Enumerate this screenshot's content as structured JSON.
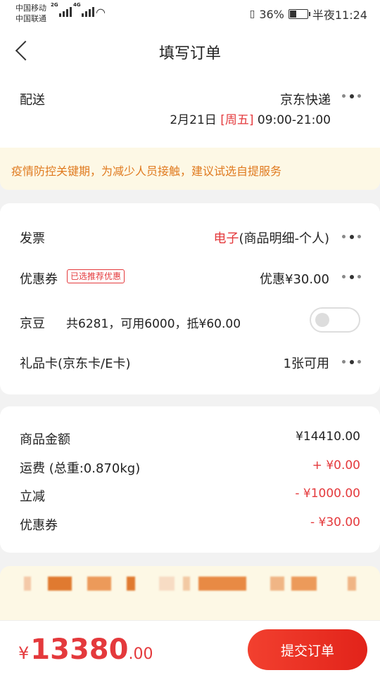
{
  "status_bar": {
    "carrier1": "中国移动",
    "carrier2": "中国联通",
    "net1": "2G",
    "net2": "4G",
    "battery": "36%",
    "battery_level": 0.36,
    "time": "半夜11:24"
  },
  "header": {
    "title": "填写订单"
  },
  "delivery": {
    "label": "配送",
    "method": "京东快递",
    "date": "2月21日",
    "weekday": "[周五]",
    "time_range": "09:00-21:00"
  },
  "notice": "疫情防控关键期，为减少人员接触，建议试选自提服务",
  "options": {
    "invoice": {
      "label": "发票",
      "type": "电子",
      "detail": "(商品明细-个人)"
    },
    "coupon": {
      "label": "优惠券",
      "tag": "已选推荐优惠",
      "value": "优惠¥30.00"
    },
    "jingdou": {
      "label": "京豆",
      "detail": "共6281，可用6000，抵¥60.00",
      "enabled": false
    },
    "giftcard": {
      "label": "礼品卡(京东卡/E卡)",
      "value": "1张可用"
    }
  },
  "summary": [
    {
      "label": "商品金额",
      "value": "¥14410.00"
    },
    {
      "label": "运费 (总重:0.870kg)",
      "value": "+ ¥0.00"
    },
    {
      "label": "立减",
      "value": "- ¥1000.00"
    },
    {
      "label": "优惠券",
      "value": "- ¥30.00"
    }
  ],
  "footer": {
    "currency": "¥",
    "total_int": "13380",
    "total_dec": ".00",
    "submit_label": "提交订单"
  },
  "colors": {
    "accent": "#e4393c",
    "notice_text": "#e07a1f",
    "notice_bg": "#fdf8e5"
  },
  "icons": [
    "back-icon",
    "more-dots-icon",
    "signal-icon",
    "wifi-icon",
    "vibrate-icon",
    "battery-icon"
  ]
}
